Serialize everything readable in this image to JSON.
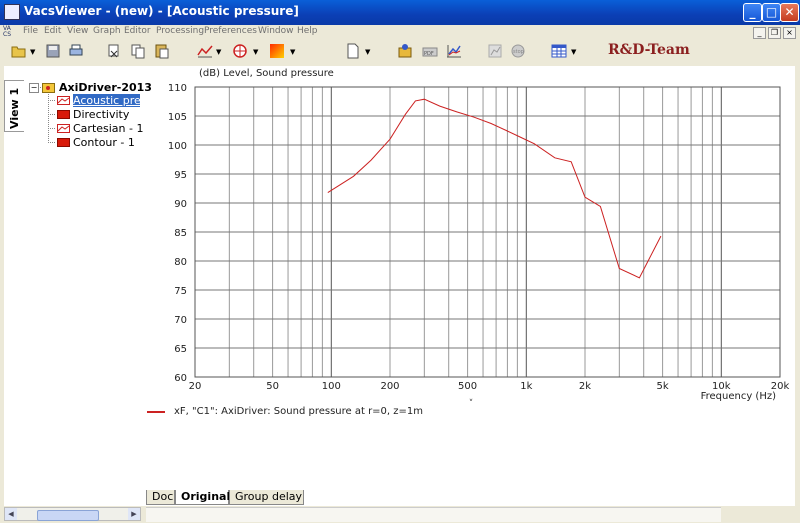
{
  "window": {
    "title": "VacsViewer - (new) - [Acoustic pressure]",
    "app_icon": "vacs-app-icon",
    "min_label": "_",
    "max_label": "□",
    "close_label": "✕"
  },
  "menu": {
    "items": [
      "File",
      "Edit",
      "View",
      "Graph",
      "Editor",
      "Processing",
      "Preferences",
      "Window",
      "Help"
    ]
  },
  "mdi_controls": {
    "min": "_",
    "restore": "❐",
    "close": "×"
  },
  "brand": "R&D-Team",
  "side_tab": "View 1",
  "tree": {
    "expander": "−",
    "root": "AxiDriver-2013",
    "items": [
      {
        "label": "Acoustic pres",
        "icon": "line-graph-icon",
        "selected": true
      },
      {
        "label": "Directivity",
        "icon": "contour-icon",
        "selected": false
      },
      {
        "label": "Cartesian - 1",
        "icon": "line-graph-icon",
        "selected": false
      },
      {
        "label": "Contour - 1",
        "icon": "contour-icon",
        "selected": false
      }
    ]
  },
  "graph": {
    "y_title": "(dB) Level, Sound pressure",
    "x_title": "Frequency  (Hz)",
    "legend": "xF, \"C1\": AxiDriver: Sound pressure at r=0, z=1m",
    "collapse_marker": "˅"
  },
  "chart_data": {
    "type": "line",
    "xscale": "log",
    "xlim": [
      20,
      20000
    ],
    "ylim": [
      60,
      110
    ],
    "xticks": [
      "20",
      "50",
      "100",
      "200",
      "500",
      "1k",
      "2k",
      "5k",
      "10k",
      "20k"
    ],
    "xtick_values": [
      20,
      50,
      100,
      200,
      500,
      1000,
      2000,
      5000,
      10000,
      20000
    ],
    "yticks": [
      "60",
      "65",
      "70",
      "75",
      "80",
      "85",
      "90",
      "95",
      "100",
      "105",
      "110"
    ],
    "ytick_values": [
      60,
      65,
      70,
      75,
      80,
      85,
      90,
      95,
      100,
      105,
      110
    ],
    "grid": true,
    "series": [
      {
        "color": "#cc2222",
        "x": [
          96,
          130,
          160,
          200,
          240,
          270,
          300,
          360,
          440,
          540,
          660,
          790,
          940,
          1100,
          1400,
          1700,
          2000,
          2400,
          3000,
          3800,
          4900
        ],
        "y": [
          91.8,
          94.6,
          97.4,
          101.0,
          105.3,
          107.6,
          107.9,
          106.7,
          105.7,
          104.8,
          103.7,
          102.5,
          101.3,
          100.2,
          97.8,
          97.1,
          91.0,
          89.4,
          78.7,
          77.1,
          84.3
        ]
      }
    ]
  },
  "bottom_tabs": [
    "Doc",
    "Original",
    "Group delay"
  ],
  "active_tab": "Original"
}
